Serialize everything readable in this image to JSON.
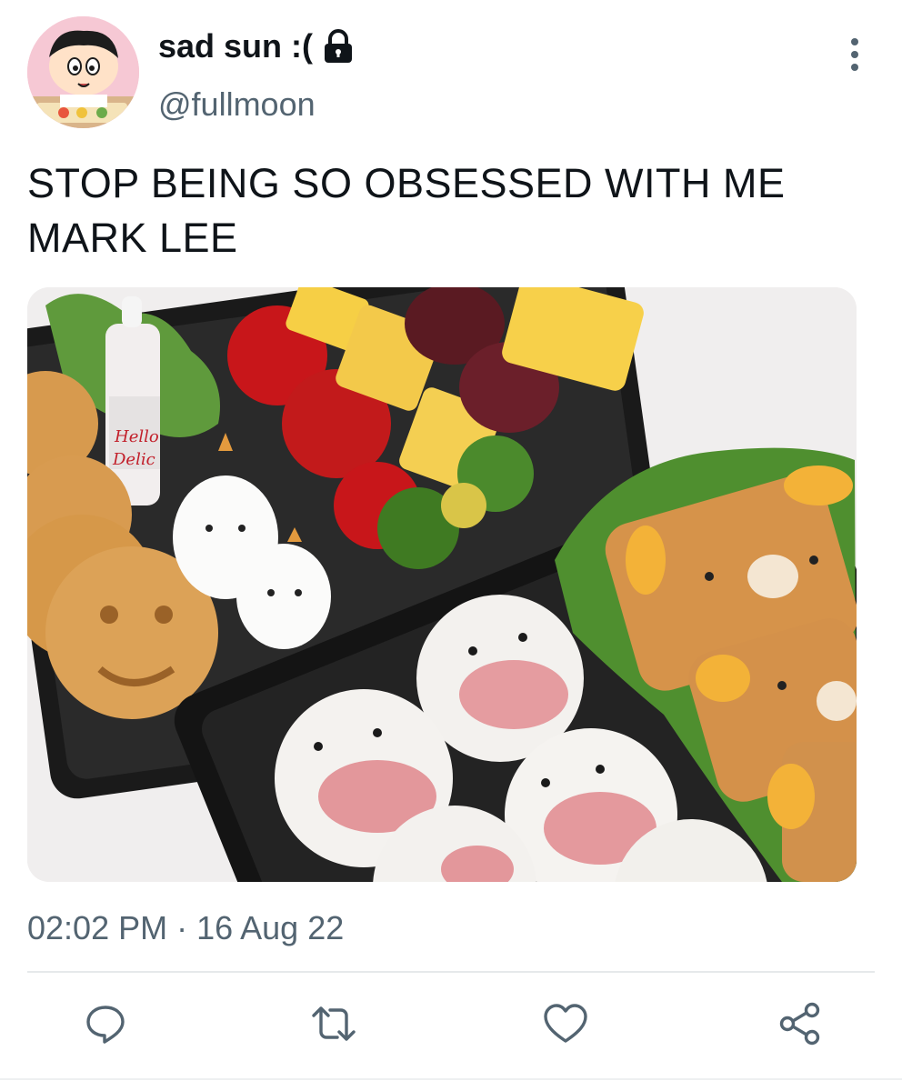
{
  "tweet": {
    "display_name": "sad sun :(",
    "handle": "@fullmoon",
    "text": "STOP BEING SO OBSESSED WITH ME MARK LEE",
    "timestamp": "02:02 PM · 16 Aug 22",
    "avatar_icon": "cartoon-boy-avatar",
    "media_description_icon": "bento-lunch-photo",
    "accent_gray": "#536471",
    "text_color": "#0f1419"
  },
  "actions": [
    {
      "name": "reply",
      "icon": "speech-bubble-icon"
    },
    {
      "name": "retweet",
      "icon": "retweet-arrows-icon"
    },
    {
      "name": "like",
      "icon": "heart-icon"
    },
    {
      "name": "share",
      "icon": "share-nodes-icon"
    }
  ]
}
